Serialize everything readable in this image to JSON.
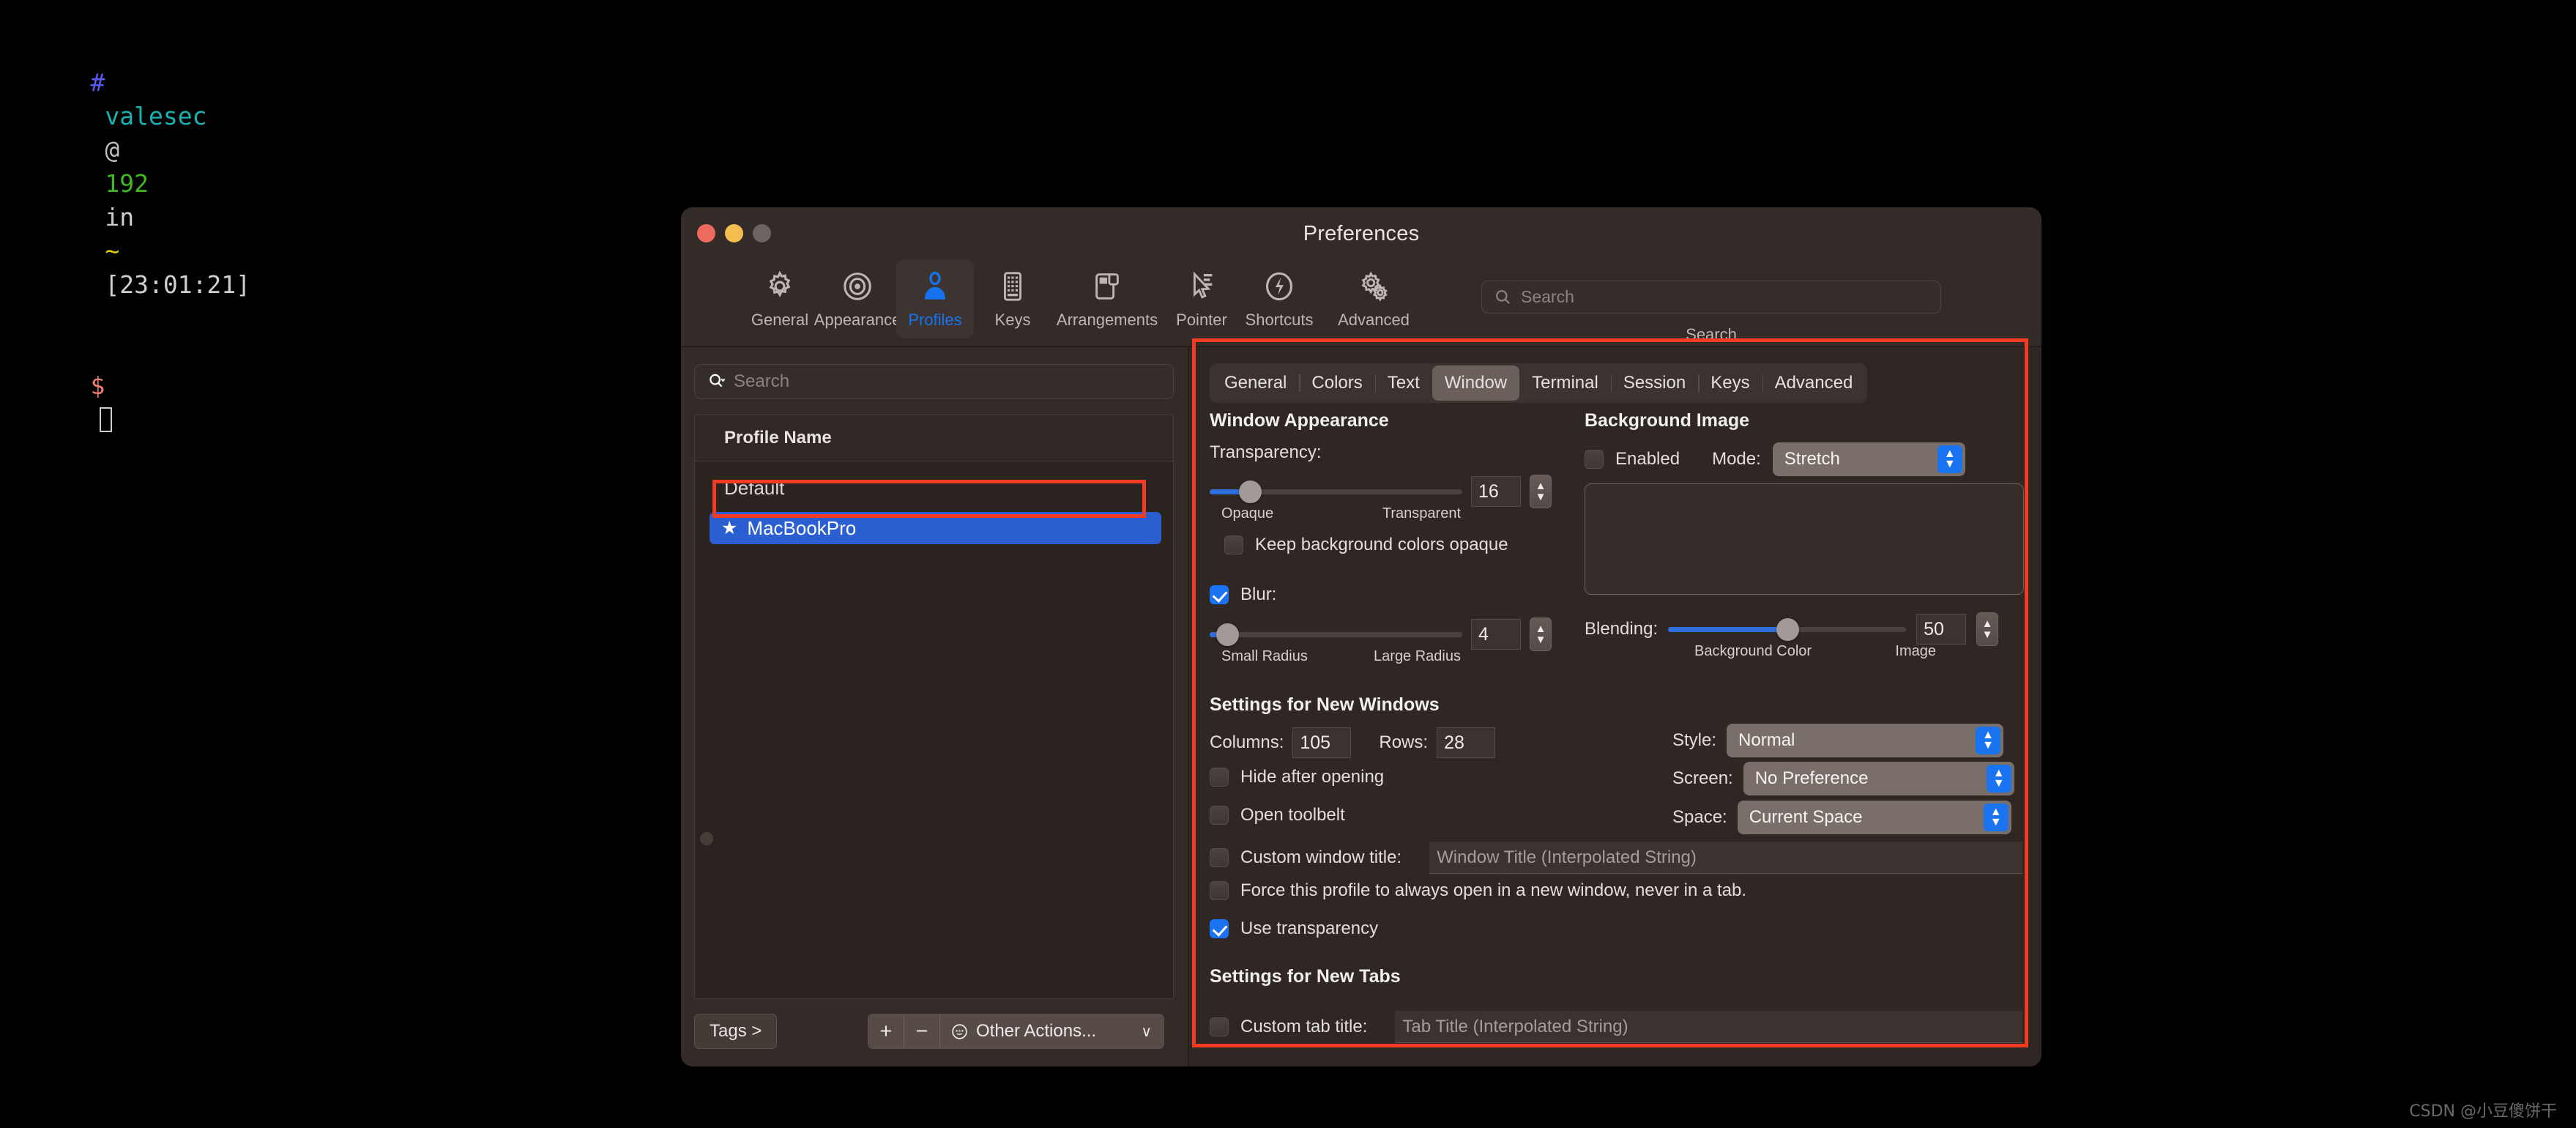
{
  "terminal": {
    "prompt_hash": "#",
    "user": "valesec",
    "at": "@",
    "host": "192",
    "in": "in",
    "tilde": "~",
    "time": "[23:01:21]",
    "dollar": "$"
  },
  "window": {
    "title": "Preferences"
  },
  "toolbar": {
    "items": [
      {
        "label": "General",
        "icon": "gear-icon"
      },
      {
        "label": "Appearance",
        "icon": "eye-icon"
      },
      {
        "label": "Profiles",
        "icon": "person-icon"
      },
      {
        "label": "Keys",
        "icon": "keyboard-icon"
      },
      {
        "label": "Arrangements",
        "icon": "window-arrangement-icon"
      },
      {
        "label": "Pointer",
        "icon": "cursor-icon"
      },
      {
        "label": "Shortcuts",
        "icon": "bolt-icon"
      },
      {
        "label": "Advanced",
        "icon": "gears-icon"
      }
    ],
    "selected": "Profiles",
    "search": {
      "placeholder": "Search",
      "value": "",
      "caption": "Search",
      "icon": "search-icon"
    }
  },
  "sidebar": {
    "search": {
      "placeholder": "Search",
      "value": "",
      "icon": "search-icon"
    },
    "table": {
      "column_header": "Profile Name",
      "rows": [
        {
          "name": "Default",
          "default_star": false,
          "selected": false
        },
        {
          "name": "MacBookPro",
          "default_star": true,
          "selected": true,
          "star_glyph": "★"
        }
      ]
    },
    "bottom": {
      "tags_label": "Tags >",
      "add_label": "+",
      "remove_label": "−",
      "other_actions_label": "Other Actions...",
      "other_actions_icon": "ellipsis-circle-icon",
      "chevron": "∨"
    },
    "grab_dot": "splitter-handle"
  },
  "profile_tabs": {
    "items": [
      "General",
      "Colors",
      "Text",
      "Window",
      "Terminal",
      "Session",
      "Keys",
      "Advanced"
    ],
    "selected": "Window"
  },
  "window_appearance": {
    "title": "Window Appearance",
    "transparency": {
      "label": "Transparency:",
      "value": "16",
      "percent": 16,
      "min_label": "Opaque",
      "max_label": "Transparent"
    },
    "keep_bg_opaque": {
      "label": "Keep background colors opaque",
      "checked": false
    },
    "blur": {
      "label": "Blur:",
      "checked": true,
      "value": "4",
      "percent": 7,
      "min_label": "Small Radius",
      "max_label": "Large Radius"
    }
  },
  "background_image": {
    "title": "Background Image",
    "enabled": {
      "label": "Enabled",
      "checked": false
    },
    "mode": {
      "label": "Mode:",
      "value": "Stretch"
    },
    "blending": {
      "label": "Blending:",
      "value": "50",
      "percent": 50,
      "min_label": "Background Color",
      "max_label": "Image"
    }
  },
  "settings_new_windows": {
    "title": "Settings for New Windows",
    "columns": {
      "label": "Columns:",
      "value": "105"
    },
    "rows": {
      "label": "Rows:",
      "value": "28"
    },
    "style": {
      "label": "Style:",
      "value": "Normal"
    },
    "screen": {
      "label": "Screen:",
      "value": "No Preference"
    },
    "space": {
      "label": "Space:",
      "value": "Current Space"
    },
    "hide_after_opening": {
      "label": "Hide after opening",
      "checked": false
    },
    "open_toolbelt": {
      "label": "Open toolbelt",
      "checked": false
    },
    "custom_window_title": {
      "label": "Custom window title:",
      "checked": false,
      "placeholder": "Window Title (Interpolated String)",
      "value": ""
    },
    "force_new_window": {
      "label": "Force this profile to always open in a new window, never in a tab.",
      "checked": false
    },
    "use_transparency": {
      "label": "Use transparency",
      "checked": true
    }
  },
  "settings_new_tabs": {
    "title": "Settings for New Tabs",
    "custom_tab_title": {
      "label": "Custom tab title:",
      "checked": false,
      "placeholder": "Tab Title (Interpolated String)",
      "value": ""
    }
  },
  "watermark": "CSDN @小豆傻饼干",
  "colors": {
    "accent_blue": "#1a73f0",
    "selection_blue": "#2a5ed1",
    "annotation_red": "#f23b22",
    "window_bg": "#332b28",
    "pane_bg": "#2e2724"
  }
}
